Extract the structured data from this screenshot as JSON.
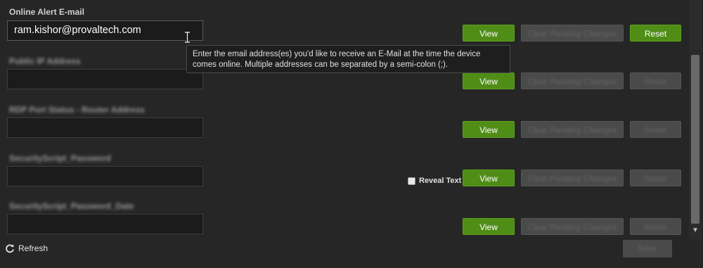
{
  "fields": [
    {
      "label": "Online Alert E-mail",
      "value": "ram.kishor@provaltech.com",
      "view_label": "View",
      "clear_label": "Clear Pending Changes",
      "reset_label": "Reset"
    },
    {
      "label": "Public IP Address",
      "value": "",
      "view_label": "View",
      "clear_label": "Clear Pending Changes",
      "reset_label": "Reset"
    },
    {
      "label": "RDP Port Status - Router Address",
      "value": "",
      "view_label": "View",
      "clear_label": "Clear Pending Changes",
      "reset_label": "Reset"
    },
    {
      "label": "SecurityScript_Password",
      "value": "",
      "view_label": "View",
      "clear_label": "Clear Pending Changes",
      "reset_label": "Reset",
      "reveal_text_label": "Reveal Text"
    },
    {
      "label": "SecurityScript_Password_Date",
      "value": "",
      "view_label": "View",
      "clear_label": "Clear Pending Changes",
      "reset_label": "Reset"
    }
  ],
  "tooltip": {
    "text": "Enter the email address(es) you'd like to receive an E-Mail at the time the device comes online. Multiple addresses can be separated by a semi-colon (;)."
  },
  "footer": {
    "refresh_label": "Refresh",
    "save_label": "Save"
  },
  "colors": {
    "accent_green": "#4f8d17",
    "background": "#262626",
    "disabled": "#4a4a4a"
  },
  "icons": {
    "refresh": "refresh-icon",
    "cursor": "text-cursor-icon",
    "scroll_down": "chevron-down-icon"
  }
}
